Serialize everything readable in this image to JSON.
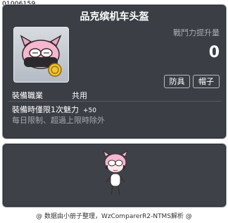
{
  "item": {
    "id": "01006159",
    "name": "品克缤机车头盔",
    "stat_label": "戰鬥力提升量",
    "stat_value": "0",
    "badges": [
      "防具",
      "帽子"
    ],
    "job_label": "裝備職業",
    "job_value": "共用",
    "effect_text": "裝備時僅限1次魅力",
    "effect_stat": "+50",
    "note": "每日限制、超過上限時除外",
    "icon": "pink-bean-helmet-icon"
  },
  "preview": {
    "icon": "character-avatar-icon"
  },
  "footer": {
    "text": "@ 数据由小册子整理，WzComparerR2-NTMS解析 @"
  },
  "colors": {
    "panel": "#3b3f45",
    "border": "#8d949c",
    "text": "#ffffff",
    "muted": "#a5a9ae"
  }
}
